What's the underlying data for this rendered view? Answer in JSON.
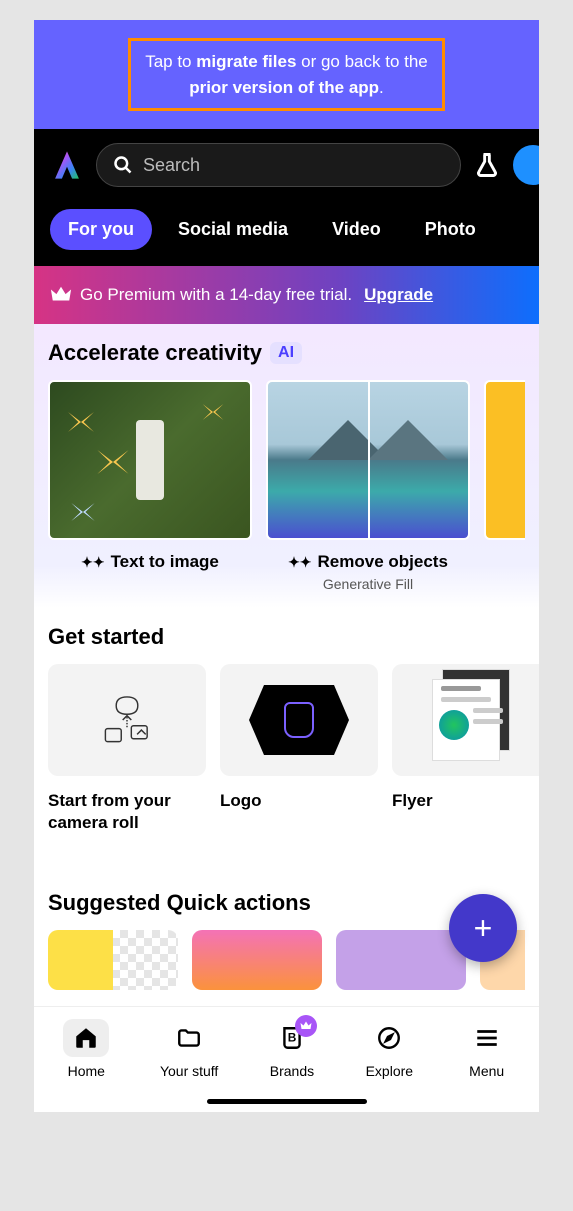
{
  "banner": {
    "pre": "Tap to ",
    "bold1": "migrate files",
    "mid": " or go back to the ",
    "bold2": "prior version of the app",
    "post": "."
  },
  "header": {
    "search_placeholder": "Search"
  },
  "tabs": [
    "For you",
    "Social media",
    "Video",
    "Photo"
  ],
  "premium": {
    "text": "Go Premium with a 14-day free trial.",
    "cta": "Upgrade"
  },
  "accelerate": {
    "heading": "Accelerate creativity",
    "badge": "AI",
    "cards": [
      {
        "title": "Text to image",
        "subtitle": ""
      },
      {
        "title": "Remove objects",
        "subtitle": "Generative Fill"
      },
      {
        "title": "",
        "subtitle": ""
      }
    ]
  },
  "get_started": {
    "heading": "Get started",
    "cards": [
      {
        "label": "Start from your camera roll"
      },
      {
        "label": "Logo"
      },
      {
        "label": "Flyer"
      }
    ]
  },
  "suggested": {
    "heading": "Suggested Quick actions"
  },
  "fab": {
    "icon": "+"
  },
  "nav": {
    "items": [
      {
        "label": "Home"
      },
      {
        "label": "Your stuff"
      },
      {
        "label": "Brands"
      },
      {
        "label": "Explore"
      },
      {
        "label": "Menu"
      }
    ]
  }
}
